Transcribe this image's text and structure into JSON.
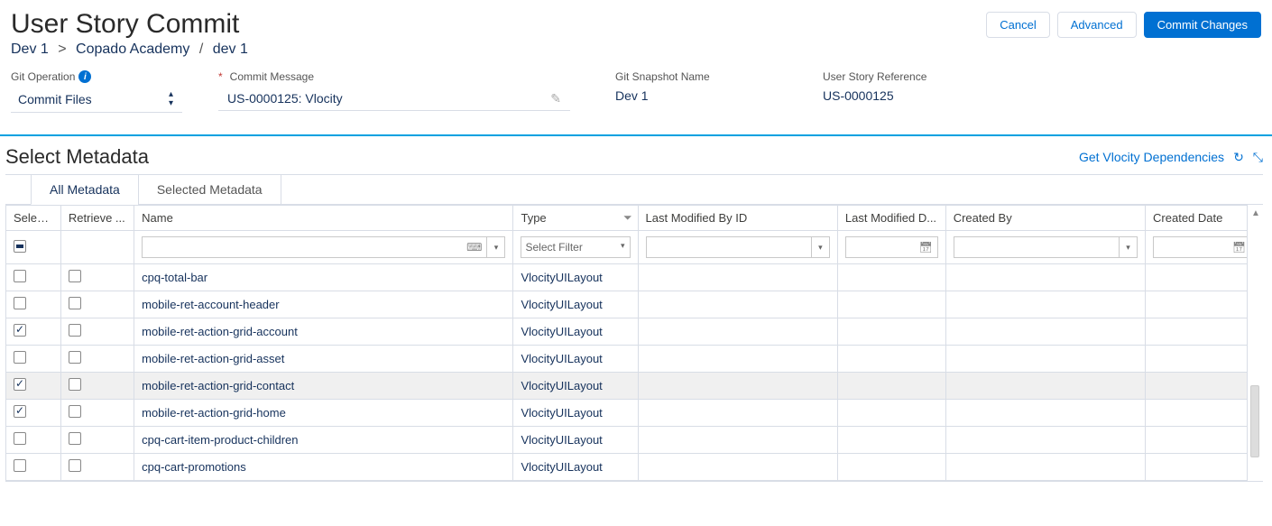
{
  "header": {
    "title": "User Story Commit",
    "actions": {
      "cancel": "Cancel",
      "advanced": "Advanced",
      "commit": "Commit Changes"
    },
    "breadcrumb": {
      "part1": "Dev 1",
      "part2": "Copado Academy",
      "part3": "dev 1"
    }
  },
  "fields": {
    "git_operation": {
      "label": "Git Operation",
      "value": "Commit Files"
    },
    "commit_message": {
      "label": "Commit Message",
      "value": "US-0000125: Vlocity"
    },
    "git_snapshot_name": {
      "label": "Git Snapshot Name",
      "value": "Dev 1"
    },
    "user_story_reference": {
      "label": "User Story Reference",
      "value": "US-0000125"
    }
  },
  "section": {
    "title": "Select Metadata",
    "link": "Get Vlocity Dependencies"
  },
  "tabs": {
    "all": "All Metadata",
    "selected": "Selected Metadata"
  },
  "grid": {
    "headers": {
      "selected": "Select...",
      "retrieve": "Retrieve ...",
      "name": "Name",
      "type": "Type",
      "lmby": "Last Modified By ID",
      "lmdate": "Last Modified D...",
      "createdby": "Created By",
      "createddate": "Created Date"
    },
    "filter_placeholder": "Select Filter",
    "rows": [
      {
        "selected": false,
        "retrieve": false,
        "name": "cpq-total-bar",
        "type": "VlocityUILayout",
        "highlight": false
      },
      {
        "selected": false,
        "retrieve": false,
        "name": "mobile-ret-account-header",
        "type": "VlocityUILayout",
        "highlight": false
      },
      {
        "selected": true,
        "retrieve": false,
        "name": "mobile-ret-action-grid-account",
        "type": "VlocityUILayout",
        "highlight": false
      },
      {
        "selected": false,
        "retrieve": false,
        "name": "mobile-ret-action-grid-asset",
        "type": "VlocityUILayout",
        "highlight": false
      },
      {
        "selected": true,
        "retrieve": false,
        "name": "mobile-ret-action-grid-contact",
        "type": "VlocityUILayout",
        "highlight": true
      },
      {
        "selected": true,
        "retrieve": false,
        "name": "mobile-ret-action-grid-home",
        "type": "VlocityUILayout",
        "highlight": false
      },
      {
        "selected": false,
        "retrieve": false,
        "name": "cpq-cart-item-product-children",
        "type": "VlocityUILayout",
        "highlight": false
      },
      {
        "selected": false,
        "retrieve": false,
        "name": "cpq-cart-promotions",
        "type": "VlocityUILayout",
        "highlight": false
      }
    ]
  }
}
